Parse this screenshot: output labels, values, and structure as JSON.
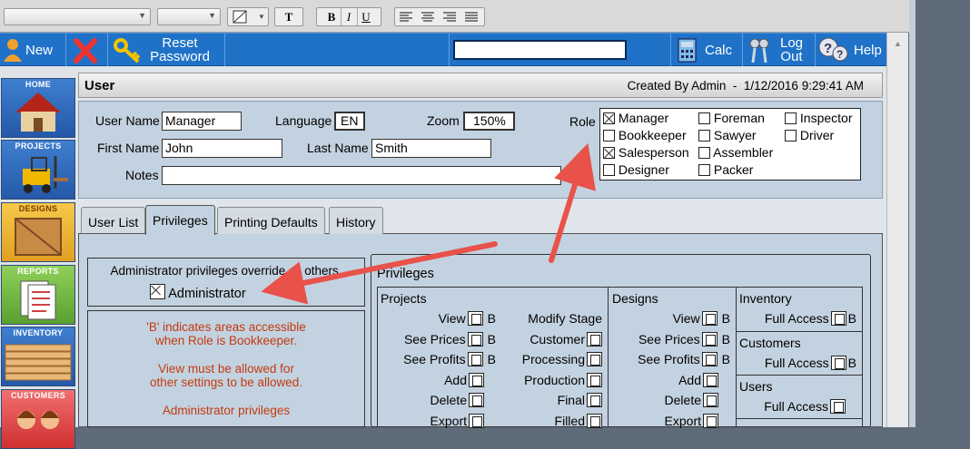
{
  "toolbar": {
    "new": "New",
    "reset1": "Reset",
    "reset2": "Password",
    "calc": "Calc",
    "logout1": "Log",
    "logout2": "Out",
    "help": "Help"
  },
  "format_bar": {
    "bold": "B",
    "italic": "I",
    "underline": "U",
    "text": "T"
  },
  "nav": [
    {
      "label": "HOME"
    },
    {
      "label": "PROJECTS"
    },
    {
      "label": "DESIGNS"
    },
    {
      "label": "REPORTS"
    },
    {
      "label": "INVENTORY"
    },
    {
      "label": "CUSTOMERS"
    }
  ],
  "header": {
    "title": "User",
    "created": "Created By Admin  -  1/12/2016 9:29:41 AM"
  },
  "user": {
    "username_label": "User Name",
    "username": "Manager",
    "language_label": "Language",
    "language": "EN",
    "zoom_label": "Zoom",
    "zoom": "150%",
    "firstname_label": "First Name",
    "firstname": "John",
    "lastname_label": "Last Name",
    "lastname": "Smith",
    "notes_label": "Notes",
    "notes": "",
    "role_label": "Role"
  },
  "roles": {
    "manager": "Manager",
    "foreman": "Foreman",
    "inspector": "Inspector",
    "bookkeeper": "Bookkeeper",
    "sawyer": "Sawyer",
    "driver": "Driver",
    "salesperson": "Salesperson",
    "assembler": "Assembler",
    "designer": "Designer",
    "packer": "Packer"
  },
  "tabs": {
    "t1": "User List",
    "t2": "Privileges",
    "t3": "Printing Defaults",
    "t4": "History"
  },
  "admin": {
    "note": "Administrator privileges override all others.",
    "label": "Administrator"
  },
  "info": {
    "l1": "'B' indicates areas accessible",
    "l2": "when Role is Bookkeeper.",
    "l3": "View must be allowed for",
    "l4": "other settings to be allowed.",
    "l5": "Administrator privileges"
  },
  "priv": {
    "title": "Privileges",
    "projects": "Projects",
    "designs": "Designs",
    "inventory": "Inventory",
    "customers": "Customers",
    "users": "Users",
    "view": "View",
    "see_prices": "See Prices",
    "see_profits": "See Profits",
    "add": "Add",
    "delete": "Delete",
    "export": "Export",
    "modify_stage": "Modify Stage",
    "customer": "Customer",
    "processing": "Processing",
    "production": "Production",
    "final": "Final",
    "filled": "Filled",
    "full_access": "Full Access",
    "b": "B"
  },
  "colors": {
    "toolbar": "#1f72c7",
    "panel": "#c3d2e0",
    "info_text": "#c43a10",
    "arrow": "#e8524a"
  }
}
